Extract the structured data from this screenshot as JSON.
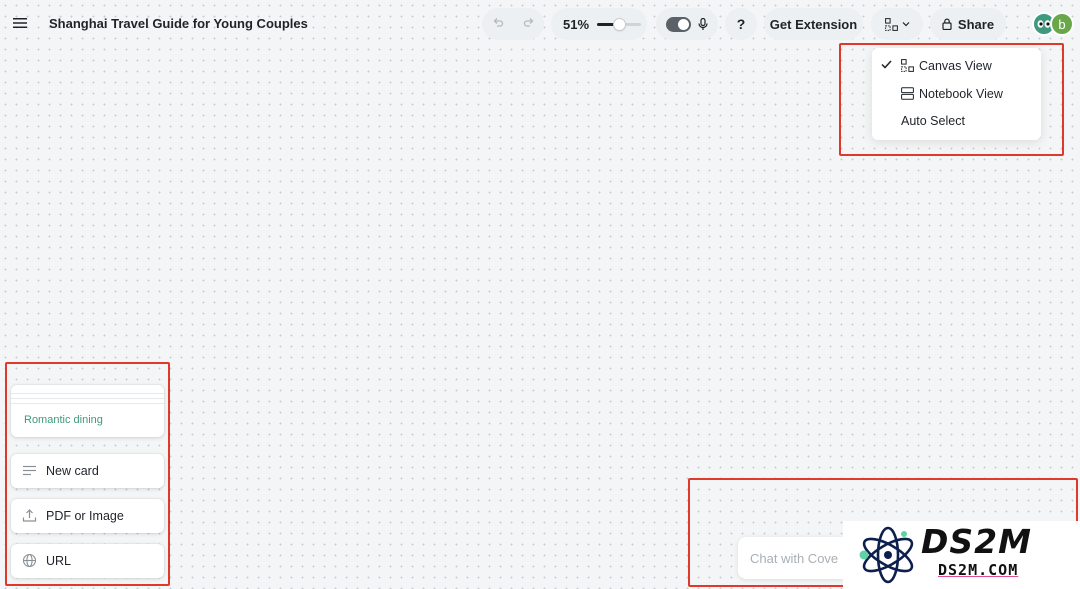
{
  "header": {
    "doc_title": "Shanghai Travel Guide for Young Couples",
    "zoom": {
      "label": "51%",
      "percent": 51
    },
    "help_label": "?",
    "extension_label": "Get Extension",
    "share_label": "Share",
    "avatars": [
      {
        "initial": ""
      },
      {
        "initial": "b"
      }
    ]
  },
  "view_menu": {
    "items": [
      {
        "label": "Canvas View",
        "checked": true,
        "icon": "canvas-view-icon"
      },
      {
        "label": "Notebook View",
        "checked": false,
        "icon": "notebook-view-icon"
      },
      {
        "label": "Auto Select",
        "checked": false,
        "icon": ""
      }
    ]
  },
  "palette": {
    "stack_label": "Romantic dining",
    "tools": [
      {
        "label": "New card",
        "icon": "text-lines-icon"
      },
      {
        "label": "PDF or Image",
        "icon": "upload-icon"
      },
      {
        "label": "URL",
        "icon": "globe-icon"
      }
    ]
  },
  "chat": {
    "placeholder": "Chat with Cove"
  },
  "watermark": {
    "title": "DS2M",
    "subtitle": "DS2M.COM"
  },
  "colors": {
    "accent_green": "#3e9a7e",
    "highlight_red": "#e0392b",
    "canvas_bg": "#f3f5f6"
  }
}
